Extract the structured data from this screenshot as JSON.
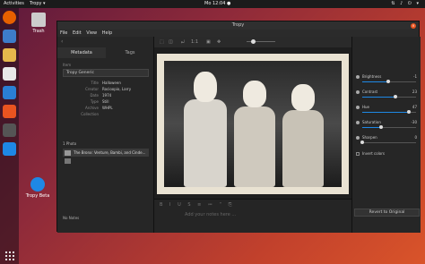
{
  "topbar": {
    "activities": "Activities",
    "app_menu": "Tropy ▾",
    "clock": "Mo 12:04 ●",
    "tray": "⇅ ♪ ⏻ ▾"
  },
  "desktop": {
    "trash_label": "Trash",
    "tropy_label": "Tropy Beta"
  },
  "window": {
    "title": "Tropy",
    "close": "×"
  },
  "menu": [
    "File",
    "Edit",
    "View",
    "Help"
  ],
  "left_panel": {
    "tabs": [
      "Metadata",
      "Tags"
    ],
    "section_label": "Item",
    "template": "Tropy Generic",
    "fields": [
      {
        "key": "Title",
        "value": "Halloween"
      },
      {
        "key": "Creator",
        "value": "Rocioopio, Larry"
      },
      {
        "key": "Date",
        "value": "1974"
      },
      {
        "key": "Type",
        "value": "Still"
      },
      {
        "key": "Archive",
        "value": "WHPL"
      },
      {
        "key": "Collection",
        "value": ""
      }
    ],
    "photos_header": "1 Photo",
    "photo_caption": "The Bronx: Venture, Bambi, and Cinde...",
    "notes_header": "No Notes"
  },
  "toolbar": {
    "icons": [
      "⬚",
      "◫",
      "⤾",
      "1:1",
      "▣",
      "✥"
    ]
  },
  "editor": {
    "tools": "B I U S ≡ ≔ “ ⎘",
    "placeholder": "Add your notes here ..."
  },
  "adjustments": [
    {
      "name": "Brightness",
      "value": "-1",
      "level": 0.49
    },
    {
      "name": "Contrast",
      "value": "23",
      "level": 0.62
    },
    {
      "name": "Hue",
      "value": "47",
      "level": 0.86
    },
    {
      "name": "Saturation",
      "value": "-30",
      "level": 0.35
    },
    {
      "name": "Sharpen",
      "value": "0",
      "level": 0.0
    }
  ],
  "invert_label": "Invert colors",
  "revert_label": "Revert to Original",
  "colors": {
    "accent": "#e95420",
    "selection": "#1e88e5"
  }
}
